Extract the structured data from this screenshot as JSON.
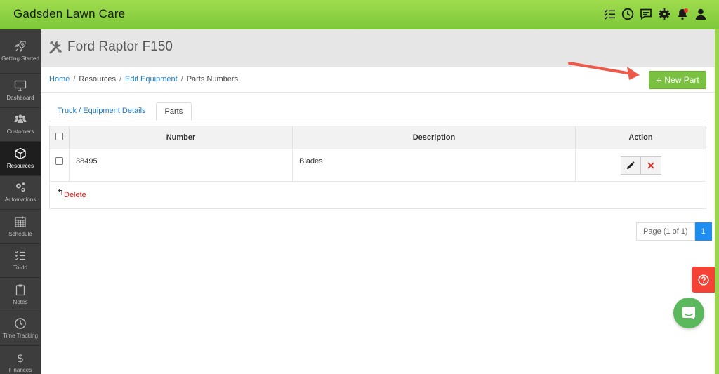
{
  "app": {
    "title": "Gadsden Lawn Care"
  },
  "topbar": {
    "icons": [
      "checklist-icon",
      "clock-icon",
      "chat-icon",
      "gear-icon",
      "bell-icon",
      "user-icon"
    ]
  },
  "sidebar": {
    "items": [
      {
        "label": "Getting Started",
        "icon": "rocket-icon"
      },
      {
        "label": "Dashboard",
        "icon": "monitor-icon"
      },
      {
        "label": "Customers",
        "icon": "users-icon"
      },
      {
        "label": "Resources",
        "icon": "box-icon",
        "active": true
      },
      {
        "label": "Automations",
        "icon": "gears-icon"
      },
      {
        "label": "Schedule",
        "icon": "calendar-icon"
      },
      {
        "label": "To-do",
        "icon": "checklist-icon"
      },
      {
        "label": "Notes",
        "icon": "clipboard-icon"
      },
      {
        "label": "Time Tracking",
        "icon": "clock-icon"
      },
      {
        "label": "Finances",
        "icon": "dollar-icon"
      }
    ]
  },
  "page": {
    "title": "Ford Raptor F150"
  },
  "breadcrumb": {
    "home": "Home",
    "resources": "Resources",
    "edit_equipment": "Edit Equipment",
    "current": "Parts Numbers",
    "sep": "/"
  },
  "actions": {
    "new_part": "New Part"
  },
  "tabs": [
    {
      "label": "Truck / Equipment Details",
      "active": false
    },
    {
      "label": "Parts",
      "active": true
    }
  ],
  "table": {
    "headers": {
      "number": "Number",
      "description": "Description",
      "action": "Action"
    },
    "rows": [
      {
        "number": "38495",
        "description": "Blades"
      }
    ]
  },
  "bulk": {
    "delete": "Delete"
  },
  "pagination": {
    "info": "Page (1 of 1)",
    "current": "1"
  },
  "colors": {
    "brand_green": "#7ac142",
    "link_blue": "#1f7bc1",
    "danger_red": "#e0201b",
    "sidebar_bg": "#3d3d3d"
  }
}
